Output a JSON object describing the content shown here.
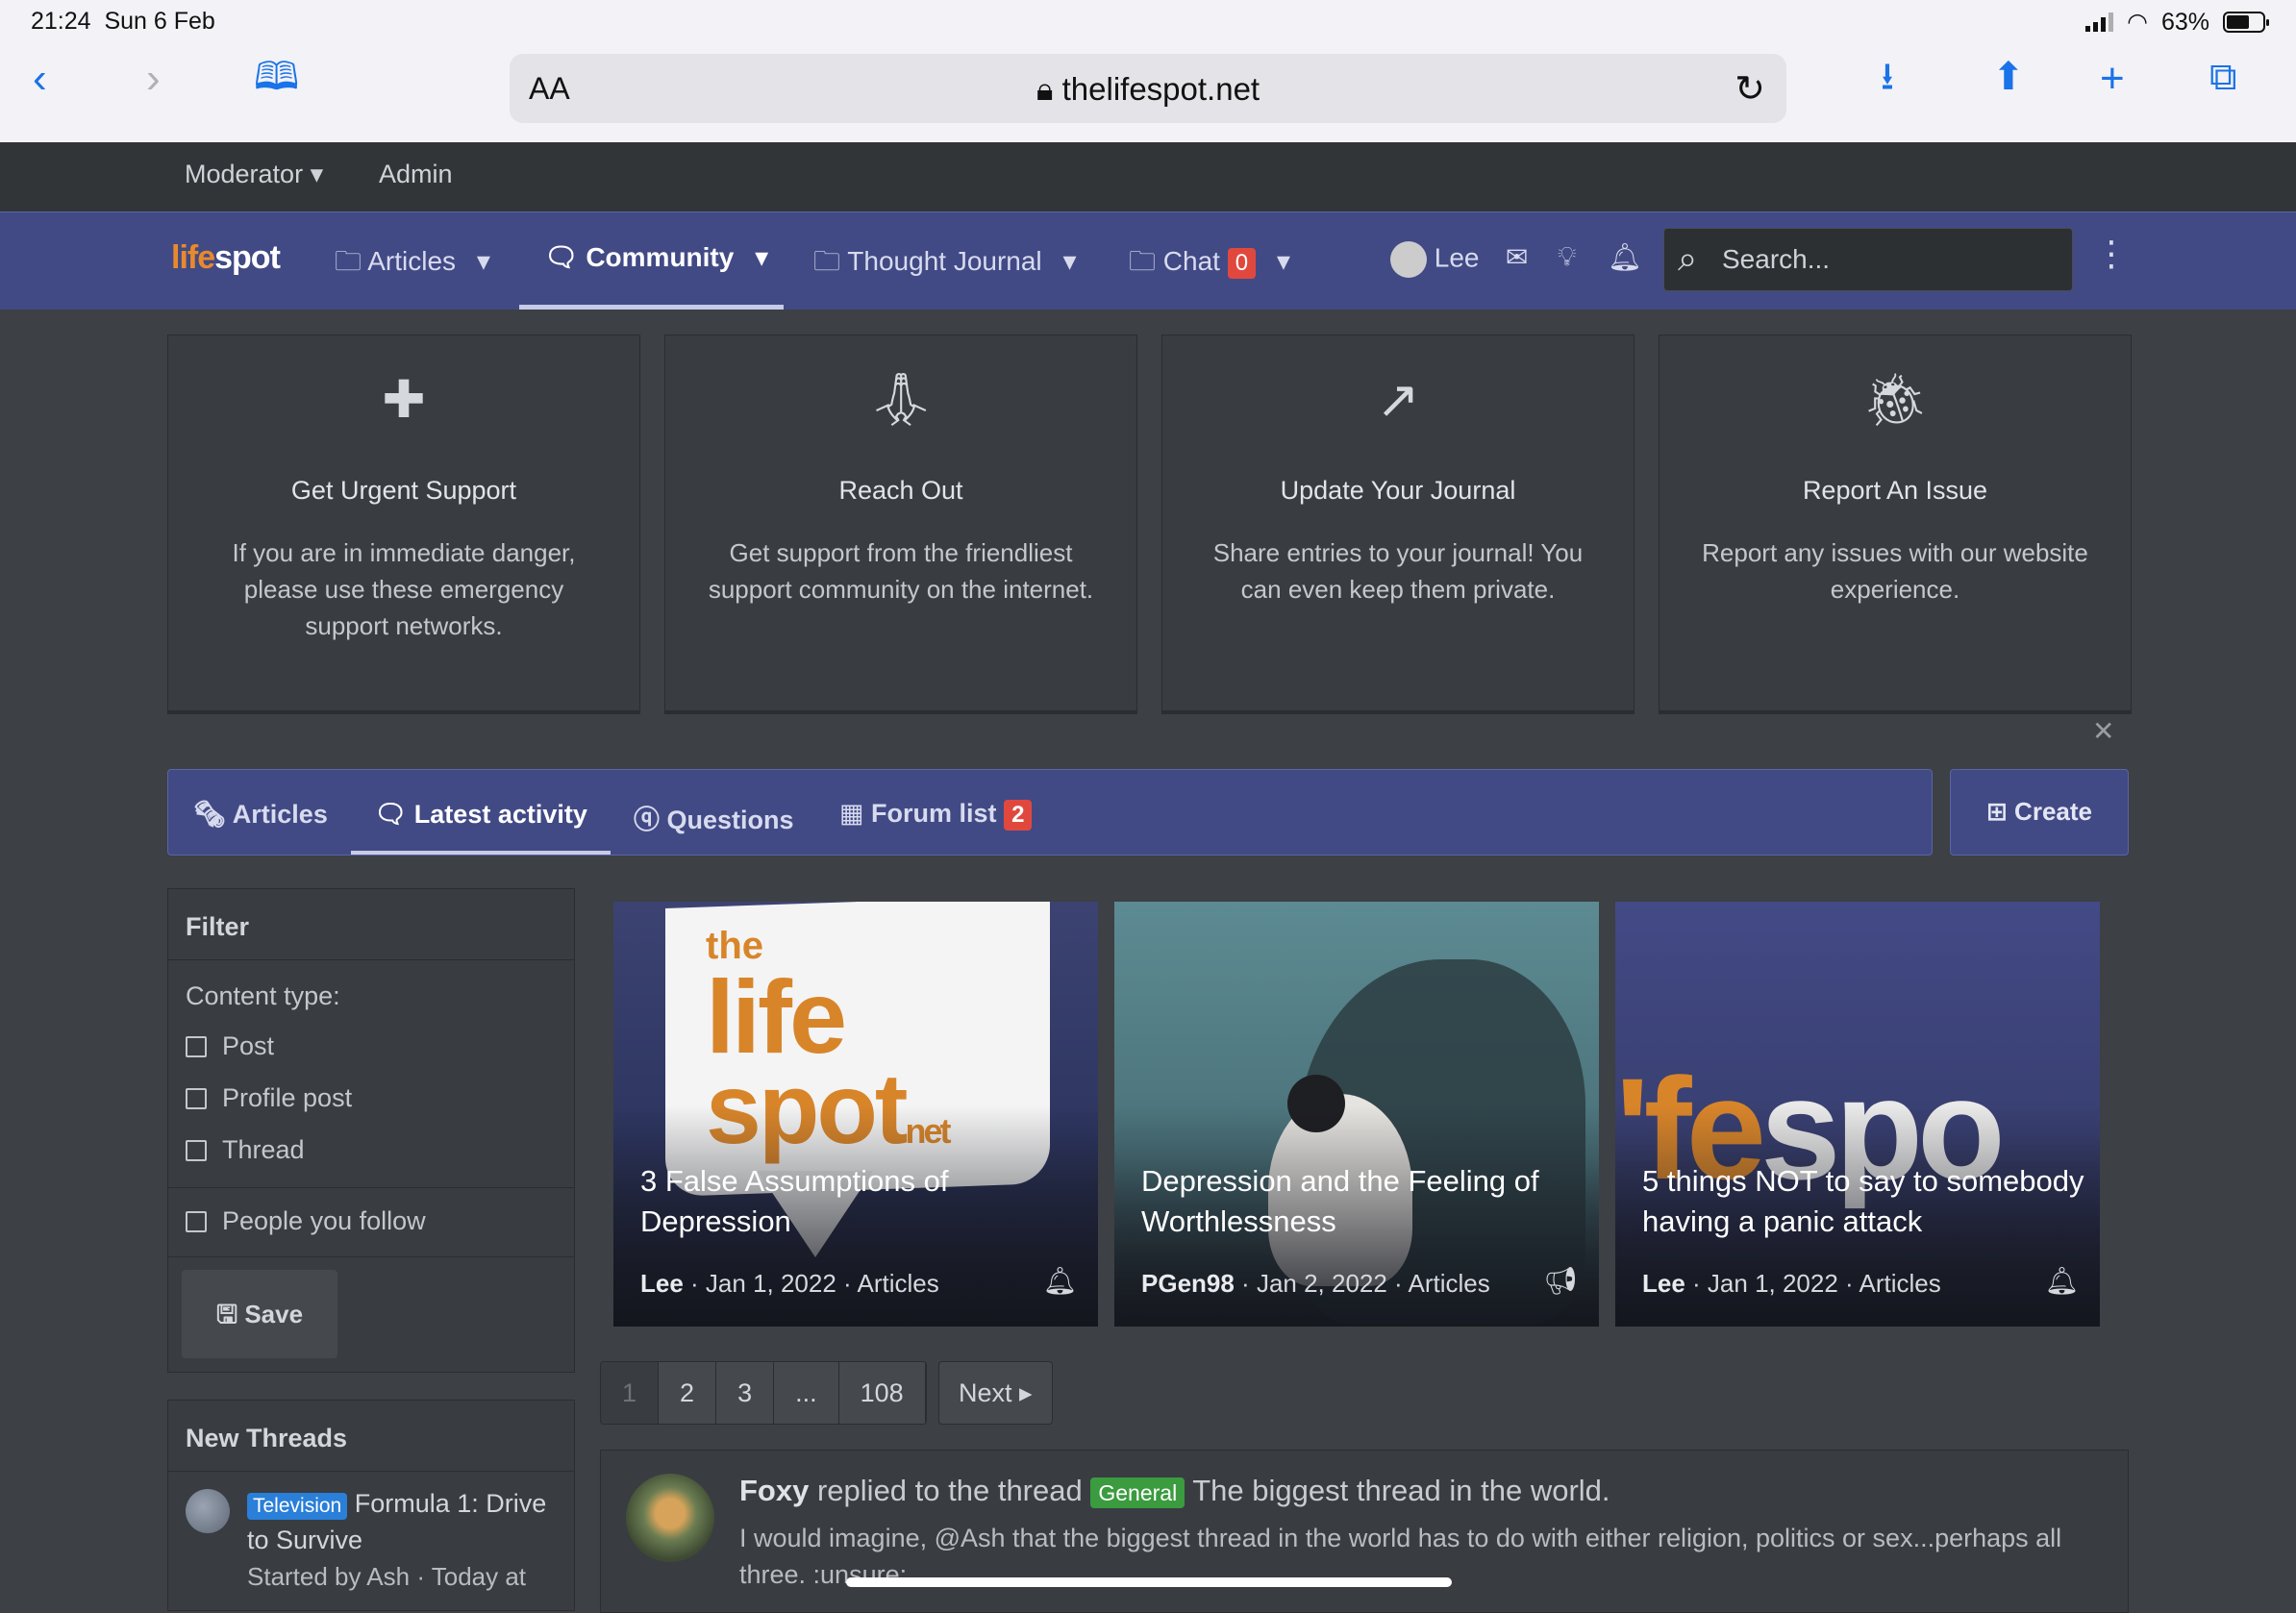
{
  "status": {
    "time": "21:24",
    "date": "Sun 6 Feb",
    "battery": "63%",
    "battery_level": 0.63
  },
  "browser": {
    "aa": "AA",
    "url": "thelifespot.net"
  },
  "staff": {
    "moderator": "Moderator",
    "admin": "Admin"
  },
  "nav": {
    "logo_prefix": "life",
    "logo_suffix": "spot",
    "tabs": [
      {
        "label": "Articles"
      },
      {
        "label": "Community"
      },
      {
        "label": "Thought Journal"
      },
      {
        "label": "Chat",
        "badge": "0"
      }
    ],
    "user": "Lee",
    "search_placeholder": "Search..."
  },
  "cards": [
    {
      "title": "Get Urgent Support",
      "text": "If you are in immediate danger, please use these emergency support networks.",
      "icon": "book-plus-icon"
    },
    {
      "title": "Reach Out",
      "text": "Get support from the friendliest support community on the internet.",
      "icon": "praying-hands-icon"
    },
    {
      "title": "Update Your Journal",
      "text": "Share entries to your journal! You can even keep them private.",
      "icon": "share-square-icon"
    },
    {
      "title": "Report An Issue",
      "text": "Report any issues with our website experience.",
      "icon": "bug-icon"
    }
  ],
  "tabs": {
    "articles": "Articles",
    "latest": "Latest activity",
    "questions": "Questions",
    "forum_list": "Forum list",
    "forum_badge": "2",
    "create": "Create"
  },
  "filter": {
    "title": "Filter",
    "content_type_label": "Content type:",
    "options": [
      "Post",
      "Profile post",
      "Thread"
    ],
    "people": "People you follow",
    "save": "Save"
  },
  "new_threads": {
    "title": "New Threads",
    "prefix": "Television",
    "thread_title": "Formula 1: Drive to Survive",
    "meta": "Started by Ash · Today at"
  },
  "articles": [
    {
      "title": "3 False Assumptions of Depression",
      "author": "Lee",
      "date": "Jan 1, 2022",
      "category": "Articles"
    },
    {
      "title": "Depression and the Feeling of Worthlessness",
      "author": "PGen98",
      "date": "Jan 2, 2022",
      "category": "Articles"
    },
    {
      "title": "5 things NOT to say to somebody having a panic attack",
      "author": "Lee",
      "date": "Jan 1, 2022",
      "category": "Articles"
    }
  ],
  "tile_art": {
    "the": "the",
    "life": "life",
    "spot": "spot",
    "net": "net",
    "fesp": "'fe",
    "spo": "spo"
  },
  "pager": {
    "pages": [
      "1",
      "2",
      "3",
      "...",
      "108"
    ],
    "next": "Next"
  },
  "activity": {
    "user": "Foxy",
    "action": "replied to the thread",
    "prefix": "General",
    "thread": "The biggest thread in the world.",
    "snippet": "I would imagine, @Ash that the biggest thread in the world has to do with either religion, politics or sex...perhaps all three. :unsure:"
  }
}
